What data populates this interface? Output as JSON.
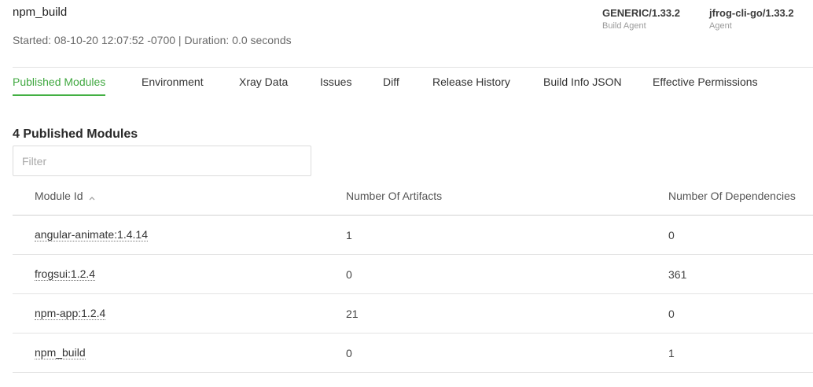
{
  "build": {
    "name": "npm_build",
    "started_label": "Started: 08-10-20 12:07:52 -0700 | Duration: 0.0 seconds"
  },
  "agents": [
    {
      "value": "GENERIC/1.33.2",
      "label": "Build Agent"
    },
    {
      "value": "jfrog-cli-go/1.33.2",
      "label": "Agent"
    }
  ],
  "tabs": [
    {
      "label": "Published Modules",
      "active": true
    },
    {
      "label": "Environment"
    },
    {
      "label": "Xray Data"
    },
    {
      "label": "Issues"
    },
    {
      "label": "Diff"
    },
    {
      "label": "Release History"
    },
    {
      "label": "Build Info JSON"
    },
    {
      "label": "Effective Permissions"
    }
  ],
  "modules": {
    "title": "4 Published Modules",
    "filter_placeholder": "Filter",
    "filter_value": "",
    "columns": [
      "Module Id",
      "Number Of Artifacts",
      "Number Of Dependencies"
    ],
    "sort_column": "Module Id",
    "sort_direction": "ascending",
    "rows": [
      {
        "module_id": "angular-animate:1.4.14",
        "artifacts": "1",
        "dependencies": "0"
      },
      {
        "module_id": "frogsui:1.2.4",
        "artifacts": "0",
        "dependencies": "361"
      },
      {
        "module_id": "npm-app:1.2.4",
        "artifacts": "21",
        "dependencies": "0"
      },
      {
        "module_id": "npm_build",
        "artifacts": "0",
        "dependencies": "1"
      }
    ]
  },
  "colors": {
    "accent": "#43b043",
    "text": "#333333",
    "muted": "#6a6a6a",
    "divider": "#e2e2e2"
  },
  "icons": {
    "sort": "chevron-up-icon"
  }
}
